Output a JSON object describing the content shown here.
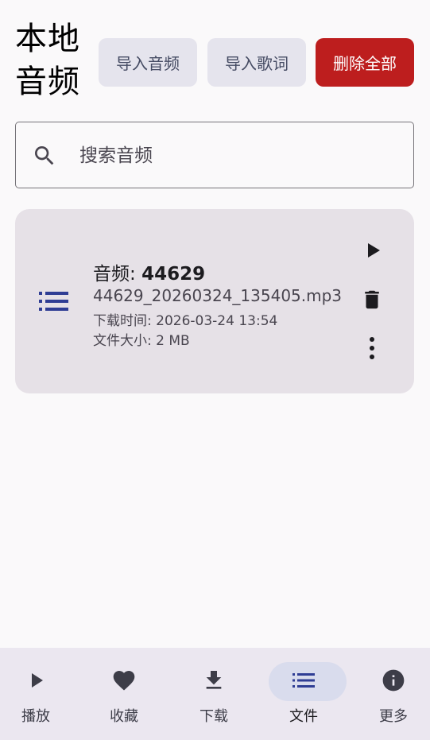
{
  "header": {
    "title_line1": "本地",
    "title_line2": "音频",
    "import_audio_label": "导入音频",
    "import_lyrics_label": "导入歌词",
    "delete_all_label": "删除全部"
  },
  "search": {
    "placeholder": "搜索音频",
    "value": ""
  },
  "files": [
    {
      "title_prefix": "音频: ",
      "title_id": "44629",
      "filename": "44629_20260324_135405.mp3",
      "download_time": "下载时间: 2026-03-24 13:54",
      "file_size": "文件大小: 2 MB"
    }
  ],
  "nav": {
    "items": [
      {
        "label": "播放",
        "icon": "play-icon"
      },
      {
        "label": "收藏",
        "icon": "heart-icon"
      },
      {
        "label": "下载",
        "icon": "download-icon"
      },
      {
        "label": "文件",
        "icon": "list-icon"
      },
      {
        "label": "更多",
        "icon": "info-icon"
      }
    ],
    "active": "文件"
  },
  "colors": {
    "danger": "#bd1e1e",
    "tonal": "#e5e4ed",
    "accent": "#2f3d94",
    "card": "#e6e1e7",
    "navbar": "#ebe7f0",
    "nav_active_pill": "#d9dced"
  }
}
